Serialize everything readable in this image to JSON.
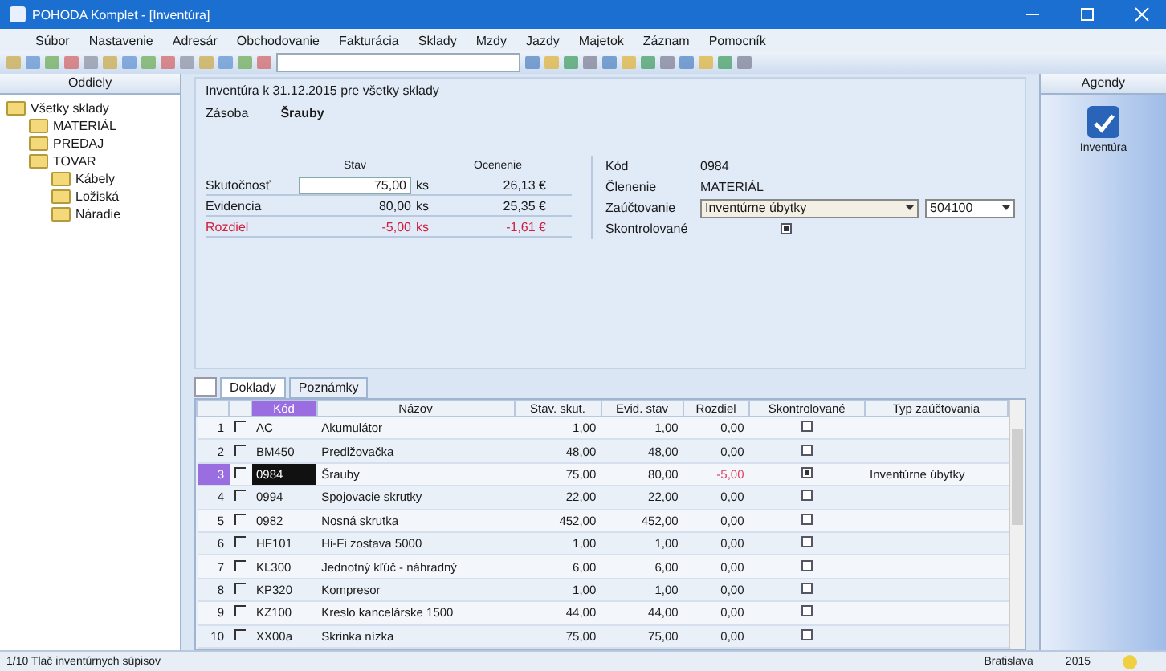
{
  "window": {
    "title": "POHODA Komplet - [Inventúra]"
  },
  "menu": [
    "Súbor",
    "Nastavenie",
    "Adresár",
    "Obchodovanie",
    "Fakturácia",
    "Sklady",
    "Mzdy",
    "Jazdy",
    "Majetok",
    "Záznam",
    "Pomocník"
  ],
  "sidebar": {
    "title": "Oddiely",
    "tree": [
      {
        "label": "Všetky sklady",
        "children": [
          {
            "label": "MATERIÁL"
          },
          {
            "label": "PREDAJ"
          },
          {
            "label": "TOVAR",
            "children": [
              {
                "label": "Kábely"
              },
              {
                "label": "Ložiská"
              },
              {
                "label": "Náradie"
              }
            ]
          }
        ]
      }
    ]
  },
  "form": {
    "heading": "Inventúra k 31.12.2015 pre všetky sklady",
    "stock_label": "Zásoba",
    "stock_value": "Šrauby",
    "col_state": "Stav",
    "col_valuation": "Ocenenie",
    "rows": [
      {
        "label": "Skutočnosť",
        "kind": "input",
        "amount": "75,00",
        "unit": "ks",
        "price": "26,13 €"
      },
      {
        "label": "Evidencia",
        "kind": "plain",
        "amount": "80,00",
        "unit": "ks",
        "price": "25,35 €"
      },
      {
        "label": "Rozdiel",
        "kind": "diff",
        "amount": "-5,00",
        "unit": "ks",
        "price": "-1,61 €"
      }
    ],
    "code_label": "Kód",
    "code_value": "0984",
    "group_label": "Členenie",
    "group_value": "MATERIÁL",
    "posting_label": "Zaúčtovanie",
    "posting_value": "Inventúrne úbytky",
    "account_value": "504100",
    "checked_label": "Skontrolované",
    "checked": true
  },
  "tabs": [
    {
      "label": "Doklady",
      "selected": true
    },
    {
      "label": "Poznámky",
      "selected": false
    }
  ],
  "table": {
    "columns": [
      "Kód",
      "Názov",
      "Stav. skut.",
      "Evid. stav",
      "Rozdiel",
      "Skontrolované",
      "Typ zaúčtovania"
    ],
    "rows": [
      {
        "n": "1",
        "code": "AC",
        "name": "Akumulátor",
        "real": "1,00",
        "evid": "1,00",
        "diff": "0,00",
        "checked": false,
        "selected": false
      },
      {
        "n": "2",
        "code": "BM450",
        "name": "Predlžovačka",
        "real": "48,00",
        "evid": "48,00",
        "diff": "0,00",
        "checked": false,
        "selected": false
      },
      {
        "n": "3",
        "code": "0984",
        "name": "Šrauby",
        "real": "75,00",
        "evid": "80,00",
        "diff": "-5,00",
        "checked": true,
        "posting": "Inventúrne úbytky",
        "selected": true
      },
      {
        "n": "4",
        "code": "0994",
        "name": "Spojovacie skrutky",
        "real": "22,00",
        "evid": "22,00",
        "diff": "0,00",
        "checked": false,
        "selected": false
      },
      {
        "n": "5",
        "code": "0982",
        "name": "Nosná skrutka",
        "real": "452,00",
        "evid": "452,00",
        "diff": "0,00",
        "checked": false,
        "selected": false
      },
      {
        "n": "6",
        "code": "HF101",
        "name": "Hi-Fi zostava 5000",
        "real": "1,00",
        "evid": "1,00",
        "diff": "0,00",
        "checked": false,
        "selected": false
      },
      {
        "n": "7",
        "code": "KL300",
        "name": "Jednotný kľúč - náhradný",
        "real": "6,00",
        "evid": "6,00",
        "diff": "0,00",
        "checked": false,
        "selected": false
      },
      {
        "n": "8",
        "code": "KP320",
        "name": "Kompresor",
        "real": "1,00",
        "evid": "1,00",
        "diff": "0,00",
        "checked": false,
        "selected": false
      },
      {
        "n": "9",
        "code": "KZ100",
        "name": "Kreslo kancelárske 1500",
        "real": "44,00",
        "evid": "44,00",
        "diff": "0,00",
        "checked": false,
        "selected": false
      },
      {
        "n": "10",
        "code": "XX00a",
        "name": "Skrinka nízka",
        "real": "75,00",
        "evid": "75,00",
        "diff": "0,00",
        "checked": false,
        "selected": false
      }
    ]
  },
  "agendas": {
    "title": "Agendy",
    "items": [
      {
        "label": "Inventúra"
      }
    ]
  },
  "status_bar": {
    "left": "1/10 Tlač inventúrnych súpisov",
    "middle": "Bratislava",
    "year": "2015"
  }
}
